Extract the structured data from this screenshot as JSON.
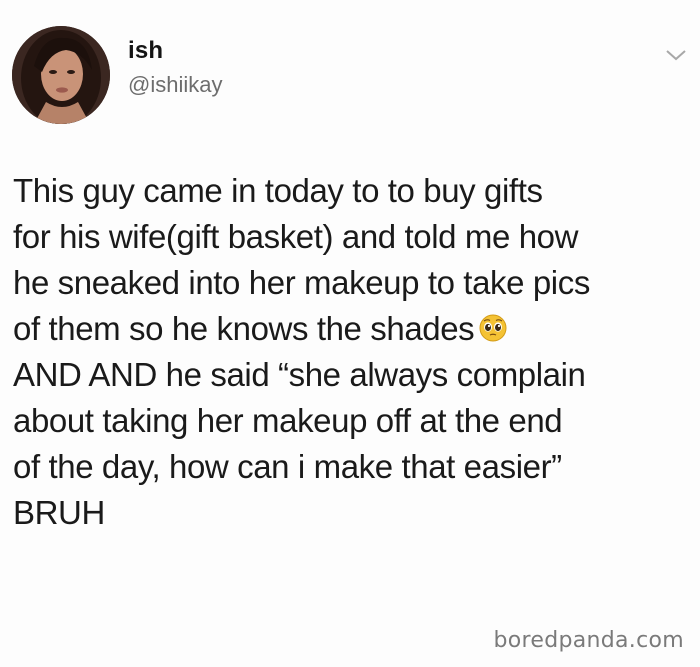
{
  "author": {
    "display_name": "ish",
    "handle": "@ishiikay"
  },
  "tweet": {
    "lines": [
      "This guy came in today to to buy gifts",
      "for his wife(gift basket) and told me how",
      "he sneaked into her makeup to take pics",
      "of them so he knows the shades",
      "AND AND he said “she always complain",
      "about taking her makeup off at the end",
      "of the day, how can i make that easier”",
      "BRUH"
    ],
    "emoji_icon": "pleading-face-emoji"
  },
  "watermark": "boredpanda.com"
}
